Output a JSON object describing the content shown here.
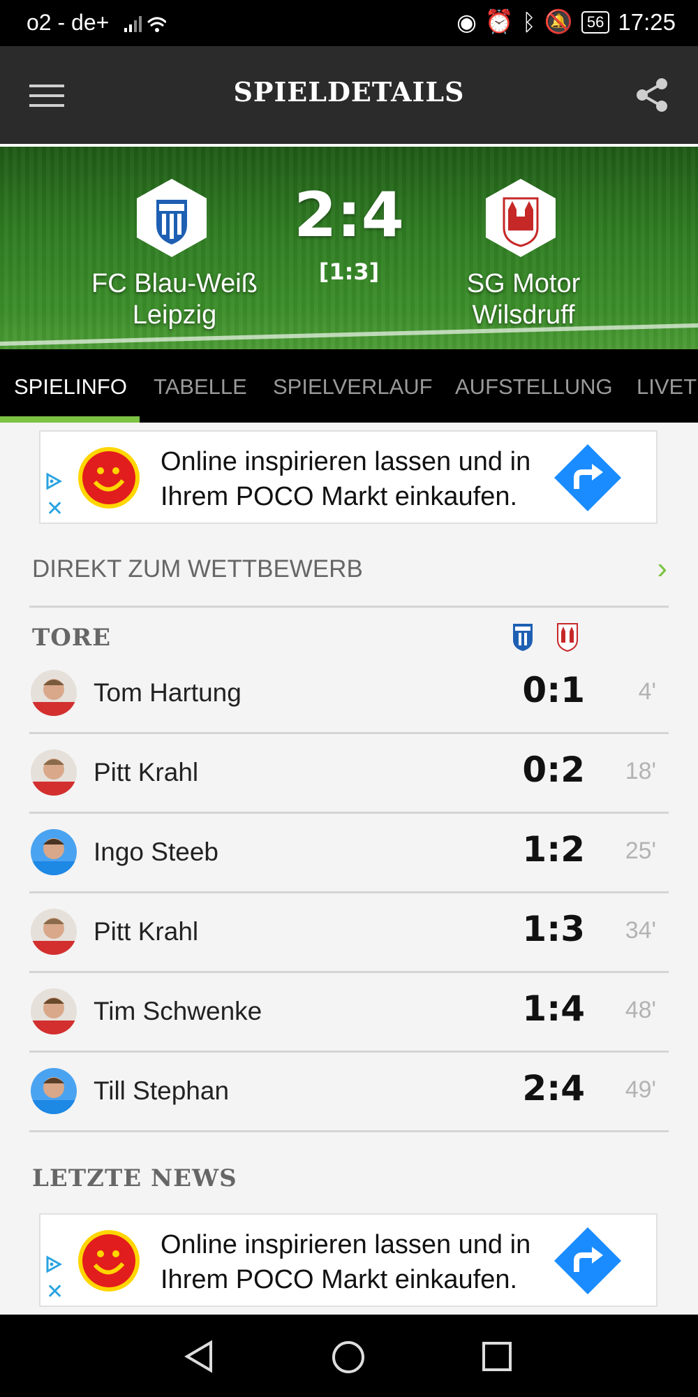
{
  "status_bar": {
    "carrier": "o2 - de+",
    "battery": "56",
    "time": "17:25"
  },
  "app_bar": {
    "title": "SPIELDETAILS"
  },
  "match": {
    "home_team": "FC Blau-Weiß Leipzig",
    "away_team": "SG Motor Wilsdruff",
    "score": "2:4",
    "halftime": "[1:3]"
  },
  "tabs": [
    {
      "label": "SPIELINFO"
    },
    {
      "label": "TABELLE"
    },
    {
      "label": "SPIELVERLAUF"
    },
    {
      "label": "AUFSTELLUNG"
    },
    {
      "label": "LIVET"
    }
  ],
  "ads": [
    {
      "line1": "Online inspirieren lassen und in",
      "line2": "Ihrem POCO Markt einkaufen."
    },
    {
      "line1": "Online inspirieren lassen und in",
      "line2": "Ihrem POCO Markt einkaufen."
    }
  ],
  "direkt": {
    "label": "DIREKT ZUM WETTBEWERB",
    "chevron": "›"
  },
  "goals_section": {
    "title": "TORE"
  },
  "goals": [
    {
      "player": "Tom Hartung",
      "score": "0:1",
      "minute": "4'",
      "team_color": "#d32f2f"
    },
    {
      "player": "Pitt Krahl",
      "score": "0:2",
      "minute": "18'",
      "team_color": "#d32f2f"
    },
    {
      "player": "Ingo Steeb",
      "score": "1:2",
      "minute": "25'",
      "team_color": "#1e88e5"
    },
    {
      "player": "Pitt Krahl",
      "score": "1:3",
      "minute": "34'",
      "team_color": "#d32f2f"
    },
    {
      "player": "Tim Schwenke",
      "score": "1:4",
      "minute": "48'",
      "team_color": "#d32f2f"
    },
    {
      "player": "Till Stephan",
      "score": "2:4",
      "minute": "49'",
      "team_color": "#1e88e5"
    }
  ],
  "news_section": {
    "title": "LETZTE NEWS"
  },
  "colors": {
    "accent": "#7cc243",
    "appbar": "#2b2b2b",
    "ad_arrow": "#1a8cff"
  }
}
